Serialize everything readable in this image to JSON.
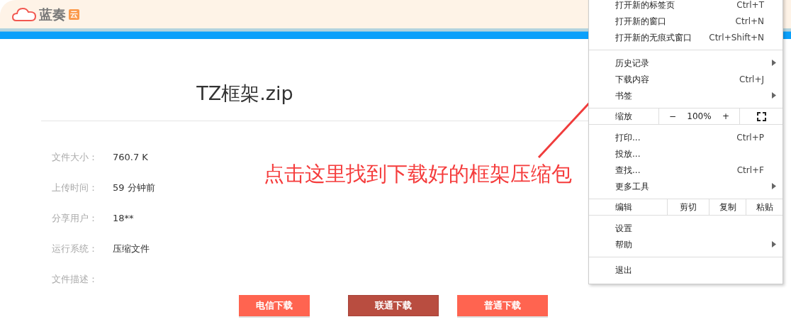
{
  "header": {
    "logo_text": "蓝奏",
    "logo_badge": "云"
  },
  "file": {
    "title": "TZ框架.zip",
    "details": [
      {
        "label": "文件大小：",
        "value": "760.7 K"
      },
      {
        "label": "上传时间：",
        "value": "59 分钟前"
      },
      {
        "label": "分享用户：",
        "value": "18**"
      },
      {
        "label": "运行系统：",
        "value": "压缩文件"
      },
      {
        "label": "文件描述："
      }
    ],
    "buttons": [
      {
        "label": "电信下载",
        "active": false
      },
      {
        "label": "联通下载",
        "active": true
      },
      {
        "label": "普通下载",
        "active": false
      }
    ]
  },
  "annotation": {
    "text": "点击这里找到下载好的框架压缩包"
  },
  "menu": {
    "groups": [
      [
        {
          "kind": "item",
          "label": "打开新的标签页",
          "shortcut": "Ctrl+T",
          "has_submenu": false
        },
        {
          "kind": "item",
          "label": "打开新的窗口",
          "shortcut": "Ctrl+N",
          "has_submenu": false
        },
        {
          "kind": "item",
          "label": "打开新的无痕式窗口",
          "shortcut": "Ctrl+Shift+N",
          "has_submenu": false
        }
      ],
      [
        {
          "kind": "item",
          "label": "历史记录",
          "has_submenu": true
        },
        {
          "kind": "item",
          "label": "下载内容",
          "shortcut": "Ctrl+J",
          "has_submenu": false
        },
        {
          "kind": "item",
          "label": "书签",
          "has_submenu": true
        }
      ],
      [
        {
          "kind": "zoom",
          "label": "缩放",
          "minus": "−",
          "value": "100%",
          "plus": "+"
        }
      ],
      [
        {
          "kind": "item",
          "label": "打印...",
          "shortcut": "Ctrl+P",
          "has_submenu": false
        },
        {
          "kind": "item",
          "label": "投放...",
          "has_submenu": false
        },
        {
          "kind": "item",
          "label": "查找...",
          "shortcut": "Ctrl+F",
          "has_submenu": false
        },
        {
          "kind": "item",
          "label": "更多工具",
          "has_submenu": true
        }
      ],
      [
        {
          "kind": "edit",
          "label": "编辑",
          "actions": [
            "剪切",
            "复制",
            "粘贴"
          ]
        }
      ],
      [
        {
          "kind": "item",
          "label": "设置",
          "has_submenu": false
        },
        {
          "kind": "item",
          "label": "帮助",
          "has_submenu": true
        }
      ],
      [
        {
          "kind": "item",
          "label": "退出",
          "has_submenu": false
        }
      ]
    ]
  }
}
